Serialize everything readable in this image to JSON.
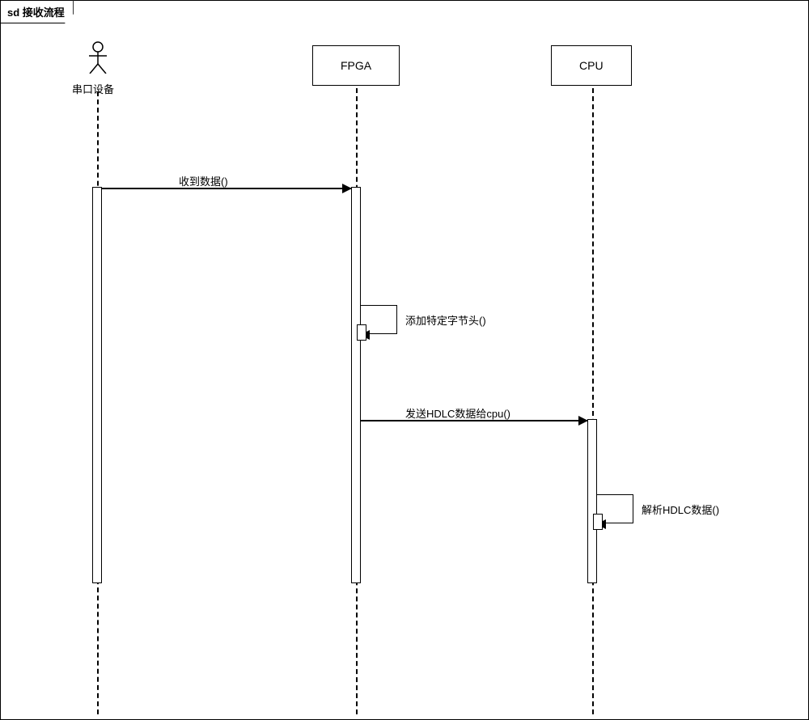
{
  "frame": {
    "title": "sd 接收流程"
  },
  "participants": {
    "actor": {
      "label": "串口设备"
    },
    "fpga": {
      "label": "FPGA"
    },
    "cpu": {
      "label": "CPU"
    }
  },
  "messages": {
    "m1": {
      "label": "收到数据()"
    },
    "m2": {
      "label": "添加特定字节头()"
    },
    "m3": {
      "label": "发送HDLC数据给cpu()"
    },
    "m4": {
      "label": "解析HDLC数据()"
    }
  }
}
